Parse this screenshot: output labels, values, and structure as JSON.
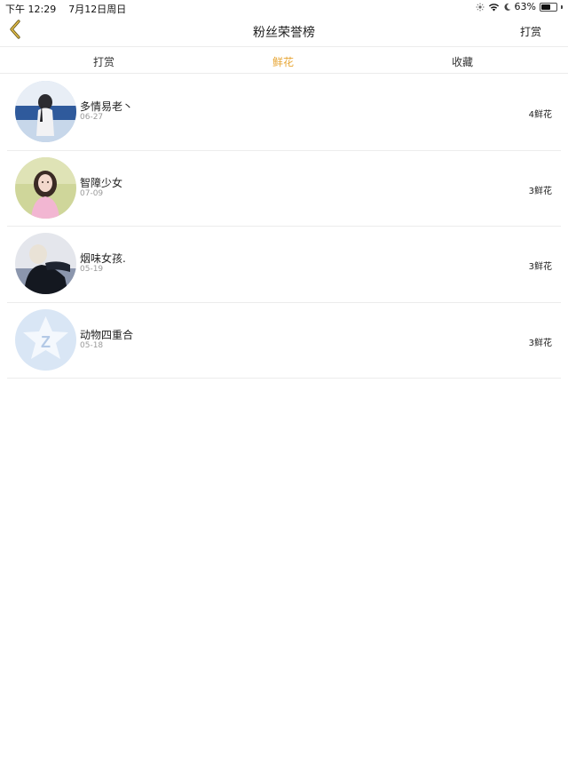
{
  "status_bar": {
    "time": "下午 12:29",
    "date": "7月12日周日",
    "battery": "63%",
    "battery_level": 0.63
  },
  "nav": {
    "title": "粉丝荣誉榜",
    "action": "打赏",
    "back_icon": "chevron-left-icon",
    "accent_color": "#e7a636"
  },
  "tabs": [
    {
      "label": "打赏",
      "active": false
    },
    {
      "label": "鲜花",
      "active": true
    },
    {
      "label": "收藏",
      "active": false
    }
  ],
  "fans": [
    {
      "name": "多情易老丶",
      "date": "06-27",
      "count": "4鲜花"
    },
    {
      "name": "智障少女",
      "date": "07-09",
      "count": "3鲜花"
    },
    {
      "name": "烟味女孩.",
      "date": "05-19",
      "count": "3鲜花"
    },
    {
      "name": "动物四重合",
      "date": "05-18",
      "count": "3鲜花"
    }
  ]
}
